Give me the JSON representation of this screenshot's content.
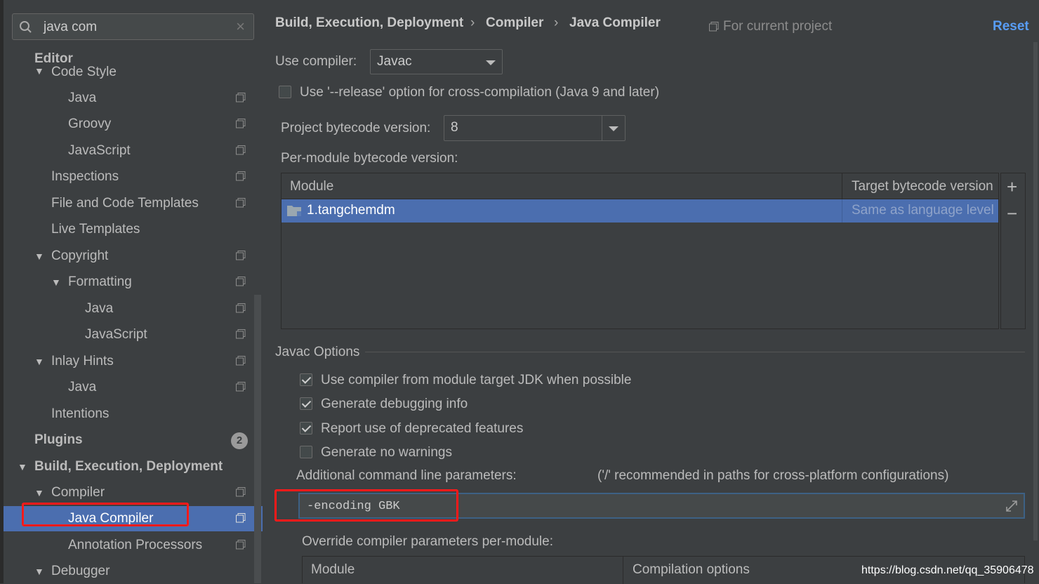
{
  "search": {
    "value": "java com"
  },
  "sidebar": {
    "items": [
      {
        "label": "Editor",
        "bold": true
      },
      {
        "label": "Code Style"
      },
      {
        "label": "Java"
      },
      {
        "label": "Groovy"
      },
      {
        "label": "JavaScript"
      },
      {
        "label": "Inspections"
      },
      {
        "label": "File and Code Templates"
      },
      {
        "label": "Live Templates"
      },
      {
        "label": "Copyright"
      },
      {
        "label": "Formatting"
      },
      {
        "label": "Java"
      },
      {
        "label": "JavaScript"
      },
      {
        "label": "Inlay Hints"
      },
      {
        "label": "Java"
      },
      {
        "label": "Intentions"
      },
      {
        "label": "Plugins",
        "bold": true
      },
      {
        "label": "Build, Execution, Deployment",
        "bold": true
      },
      {
        "label": "Compiler"
      },
      {
        "label": "Java Compiler",
        "selected": true
      },
      {
        "label": "Annotation Processors"
      },
      {
        "label": "Debugger"
      }
    ],
    "plugins_badge": "2"
  },
  "breadcrumb": {
    "part1": "Build, Execution, Deployment",
    "part2": "Compiler",
    "part3": "Java Compiler",
    "sep": "›"
  },
  "header": {
    "scope": "For current project",
    "reset": "Reset"
  },
  "compiler": {
    "use_compiler_label": "Use compiler:",
    "use_compiler_value": "Javac",
    "release_option": "Use '--release' option for cross-compilation (Java 9 and later)",
    "bytecode_label": "Project bytecode version:",
    "bytecode_value": "8",
    "per_module_label": "Per-module bytecode version:"
  },
  "module_table": {
    "col_module": "Module",
    "col_target": "Target bytecode version",
    "rows": [
      {
        "module": "1.tangchemdm",
        "target": "Same as language level"
      }
    ],
    "add": "+",
    "remove": "−"
  },
  "javac": {
    "section": "Javac Options",
    "opt1": "Use compiler from module target JDK when possible",
    "opt2": "Generate debugging info",
    "opt3": "Report use of deprecated features",
    "opt4": "Generate no warnings",
    "params_label": "Additional command line parameters:",
    "params_hint": "('/' recommended in paths for cross-platform configurations)",
    "params_value": "-encoding GBK",
    "override_label": "Override compiler parameters per-module:"
  },
  "override_table": {
    "col_module": "Module",
    "col_options": "Compilation options"
  },
  "watermark": "https://blog.csdn.net/qq_35906478",
  "colors": {
    "accent": "#4b6eaf",
    "link": "#589df6",
    "highlight": "#ff1a1a",
    "background": "#3c3f41"
  }
}
